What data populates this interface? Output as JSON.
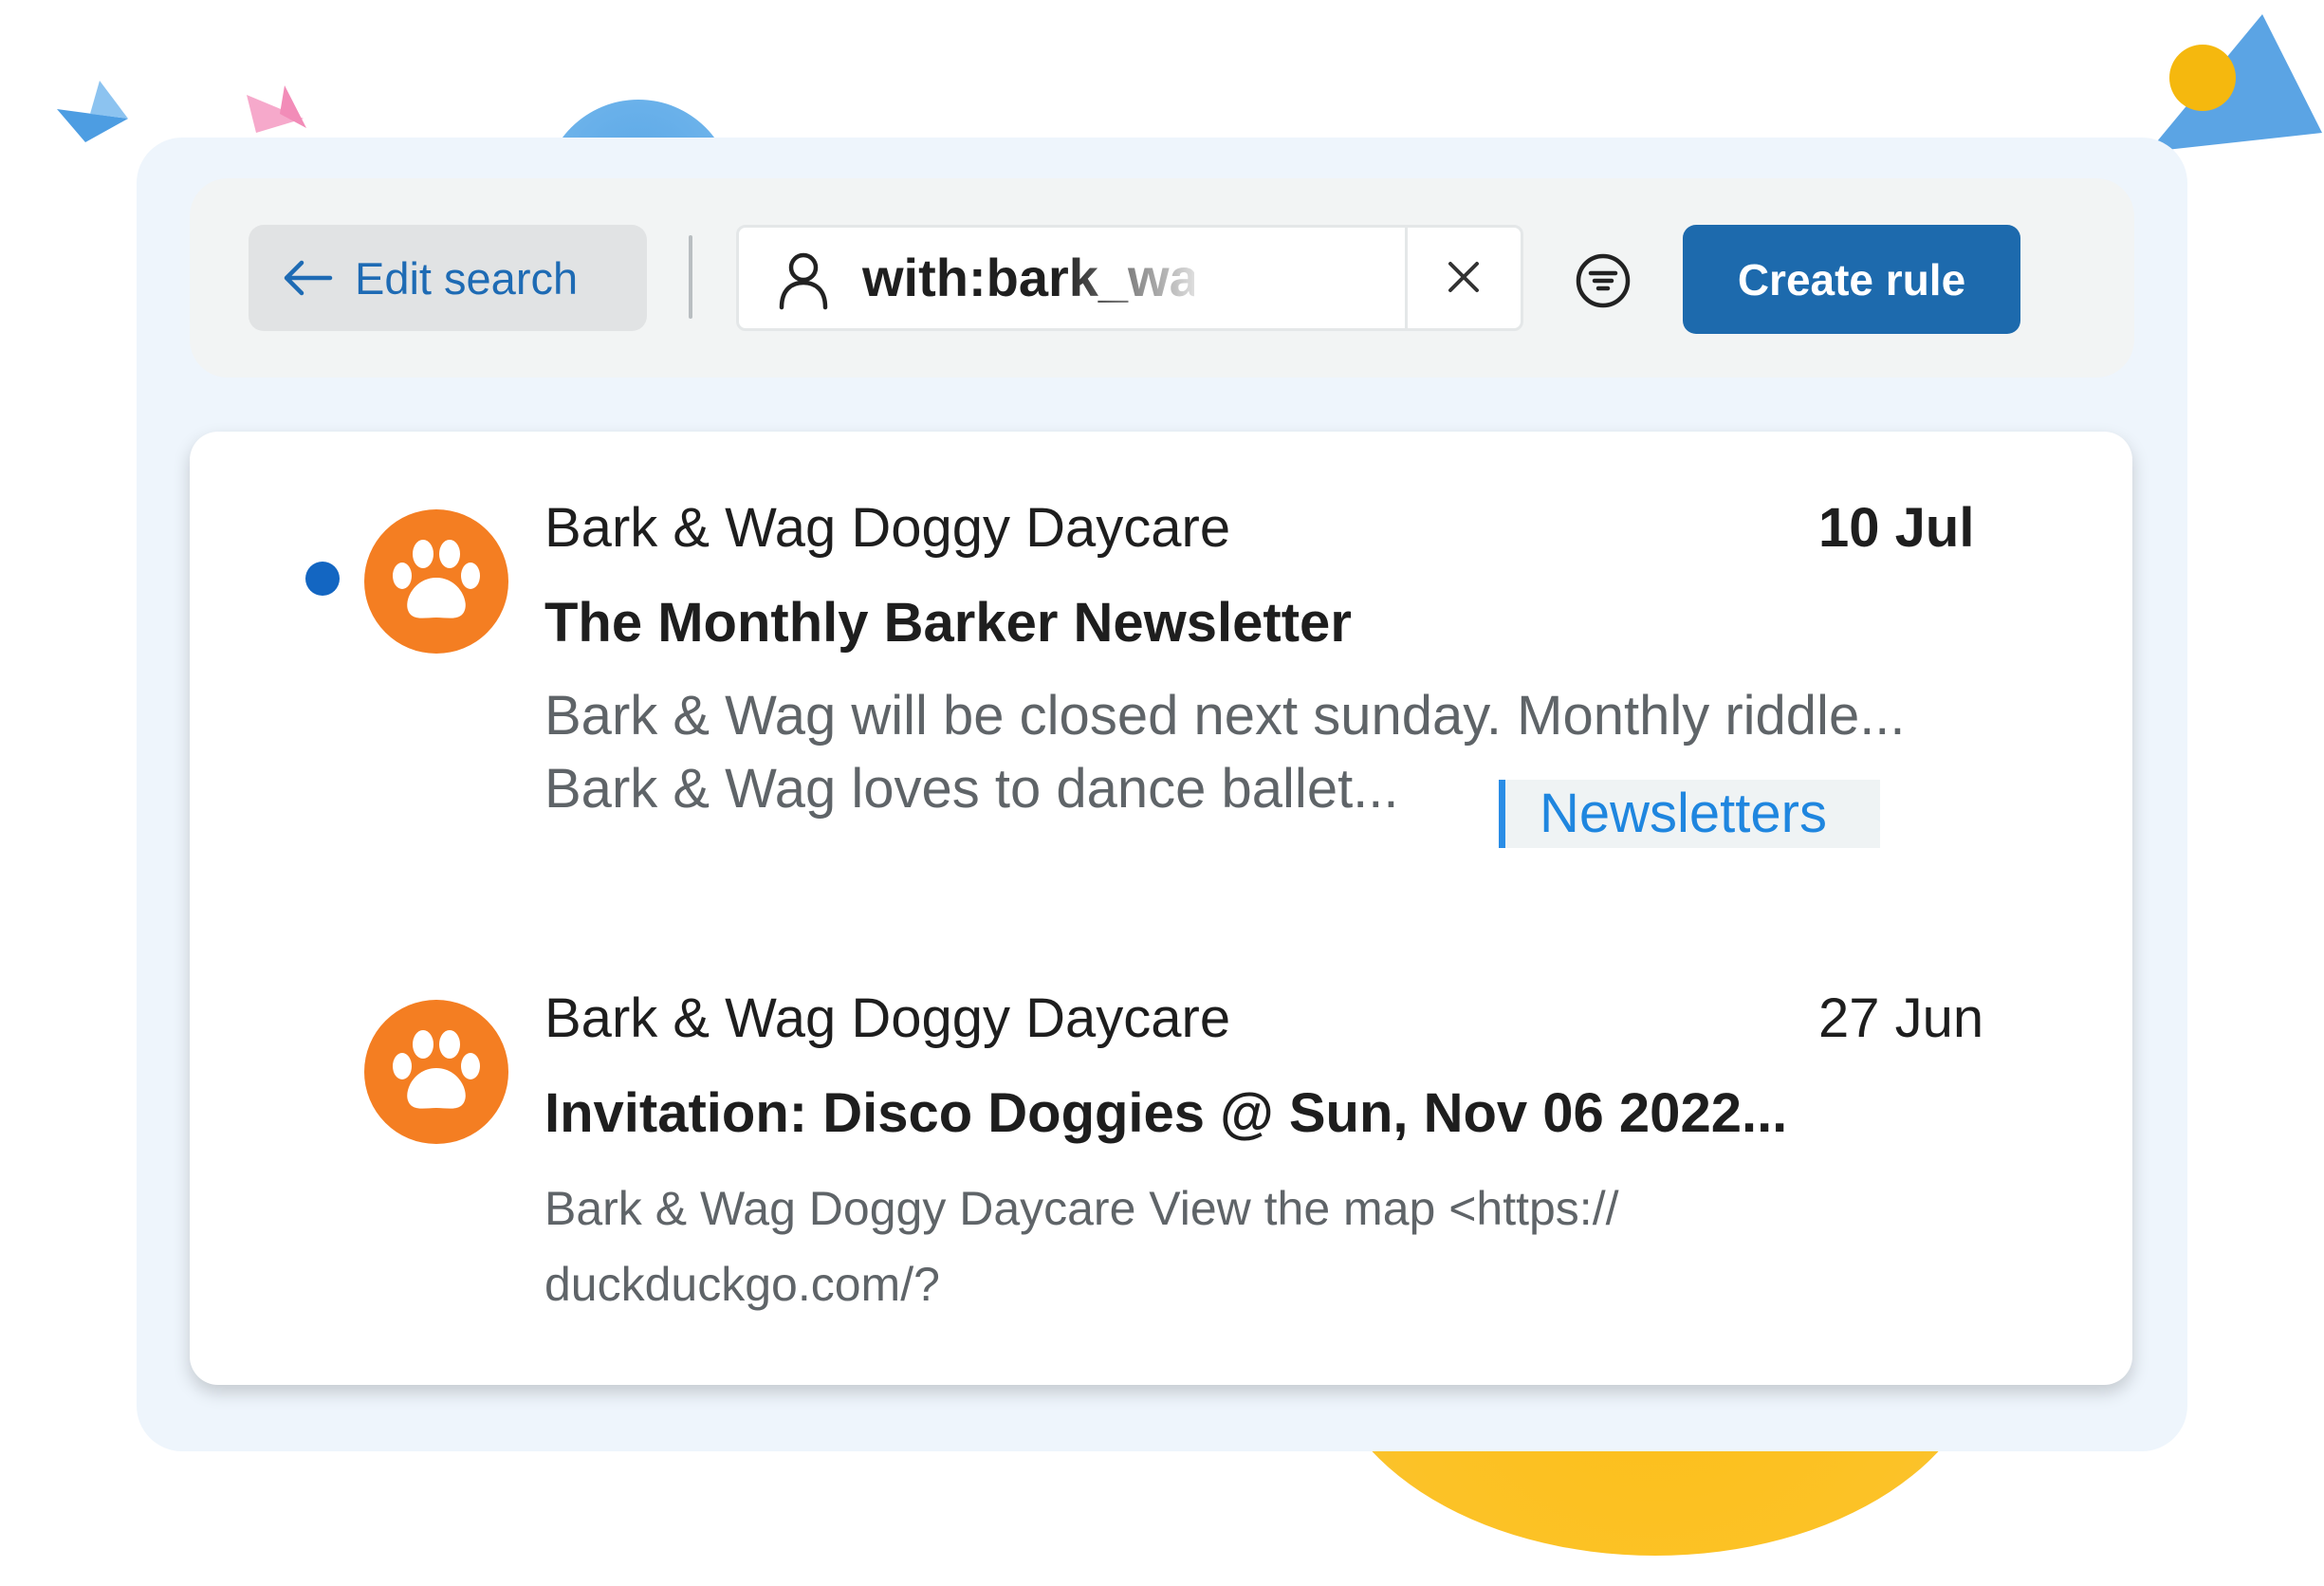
{
  "toolbar": {
    "edit_search_label": "Edit search",
    "search_query": "with:bark_wag@fa",
    "create_rule_label": "Create rule"
  },
  "messages": [
    {
      "sender": "Bark & Wag Doggy Daycare",
      "date": "10 Jul",
      "subject": "The Monthly Barker Newsletter",
      "snippet_line1": "Bark & Wag will be closed next sunday. Monthly riddle...",
      "snippet_line2": "Bark & Wag loves to dance ballet...",
      "label": "Newsletters",
      "unread": true,
      "avatar_icon": "paw-icon"
    },
    {
      "sender": "Bark & Wag Doggy Daycare",
      "date": "27 Jun",
      "subject": "Invitation: Disco Doggies @ Sun, Nov 06 2022...",
      "snippet_line1": "Bark & Wag Doggy Daycare View the map <https://",
      "snippet_line2": "duckduckgo.com/?",
      "unread": false,
      "avatar_icon": "paw-icon"
    }
  ],
  "colors": {
    "accent_blue": "#1d6aad",
    "avatar_orange": "#f47e22",
    "unread_dot": "#1366c2",
    "label_blue": "#1f86df"
  }
}
